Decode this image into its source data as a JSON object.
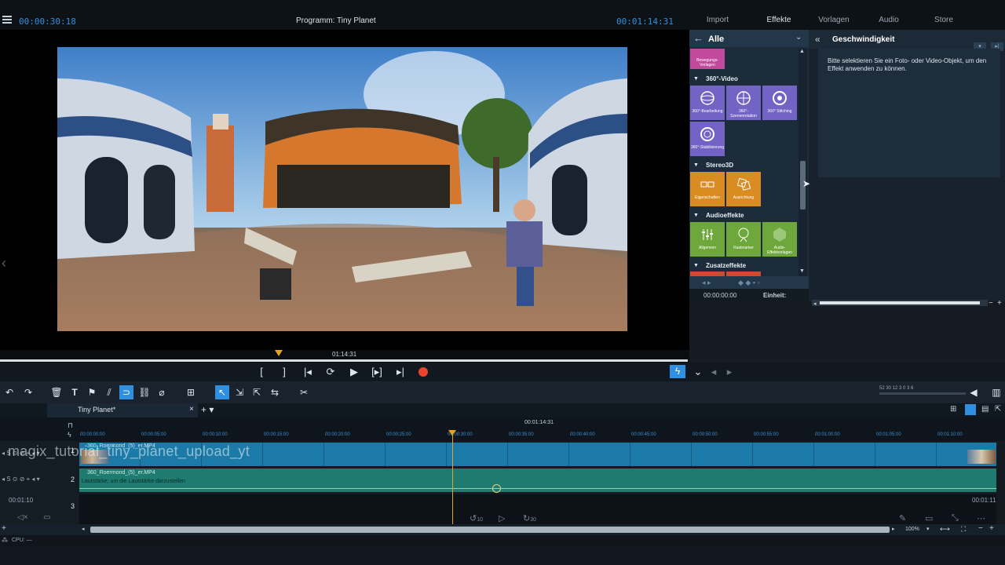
{
  "header": {
    "timecode_left": "00:00:30:18",
    "program_title": "Programm: Tiny Planet",
    "timecode_right": "00:01:14:31",
    "tabs": [
      "Import",
      "Effekte",
      "Vorlagen",
      "Audio",
      "Store"
    ]
  },
  "preview": {
    "scrub_time": "01:14:31"
  },
  "effects": {
    "category": "Alle",
    "top_tile": "Bewegungs-Vorlagen",
    "sections": [
      {
        "name": "360°-Video",
        "items": [
          "360°-Bearbeitung",
          "360°-Szenenrotation",
          "360° Stitching",
          "360°-Stabilisierung"
        ]
      },
      {
        "name": "Stereo3D",
        "items": [
          "Eigenschaften",
          "Ausrichtung"
        ]
      },
      {
        "name": "Audioeffekte",
        "items": [
          "Allgemein",
          "Rastmarker",
          "Audio-Effektvorlagen"
        ]
      },
      {
        "name": "Zusatzeffekte",
        "items": []
      }
    ],
    "time": "00:00:00:00",
    "unit_label": "Einheit:"
  },
  "properties": {
    "title": "Geschwindigkeit",
    "hint": "Bitte selektieren Sie ein Foto- oder Video-Objekt, um den Effekt anwenden zu können."
  },
  "timeline": {
    "project_tab": "Tiny Planet*",
    "position": "00:01:14:31",
    "ruler": [
      "00:00:00:00",
      "00:00:05:00",
      "00:00:10:00",
      "00:00:15:00",
      "00:00:20:00",
      "00:00:25:00",
      "00:00:30:00",
      "00:00:35:00",
      "00:00:40:00",
      "00:00:45:00",
      "00:00:50:00",
      "00:00:55:00",
      "00:01:00:00",
      "00:01:05:00",
      "00:01:10:00"
    ],
    "clip1_label": "360_Roermond_(5)_er.MP4",
    "clip2_label": "360_Roermond_(5)_er.MP4",
    "clip2_sub": "Lautstärke; um die Lautstärke darzustellen",
    "watermark": "magix_tutorial_tiny_planet_upload_yt",
    "track_numbers": [
      "1",
      "2",
      "3"
    ],
    "track3_time_left": "00:01:10",
    "track3_time_right": "00:01:11",
    "vu_scale": "52 30 12   3 0 3 6",
    "zoom": "100%",
    "skip_back": "10",
    "skip_forward": "30"
  },
  "status": {
    "cpu": "CPU: —"
  },
  "colors": {
    "accent": "#2f8fe0",
    "playhead": "#e8a21c",
    "record": "#e8452c",
    "video_track": "#1c7aa8",
    "audio_track": "#1f7b70"
  }
}
